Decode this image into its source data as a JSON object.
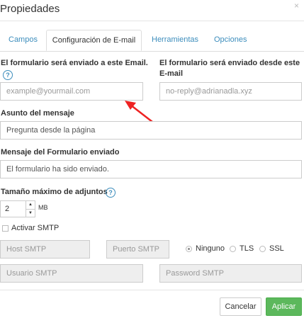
{
  "dialog": {
    "title": "Propiedades",
    "close": "×"
  },
  "tabs": [
    {
      "label": "Campos",
      "active": false
    },
    {
      "label": "Configuración de E-mail",
      "active": true
    },
    {
      "label": "Herramientas",
      "active": false
    },
    {
      "label": "Opciones",
      "active": false
    }
  ],
  "form": {
    "to_email": {
      "label": "El formulario será enviado a este Email.",
      "help": "?",
      "placeholder": "example@yourmail.com"
    },
    "from_email": {
      "label_line1": "El formulario será enviado desde este",
      "label_line2": "E-mail",
      "placeholder": "no-reply@adrianadla.xyz"
    },
    "subject": {
      "label": "Asunto del mensaje",
      "value": "Pregunta desde la página"
    },
    "sent_message": {
      "label": "Mensaje del Formulario enviado",
      "value": "El formulario ha sido enviado."
    },
    "max_attachment": {
      "label": "Tamaño máximo de adjuntos",
      "help": "?",
      "value": "2",
      "unit": "MB"
    },
    "smtp": {
      "activate_label": "Activar SMTP",
      "activated": false,
      "host_placeholder": "Host SMTP",
      "port_placeholder": "Puerto SMTP",
      "security_options": [
        "Ninguno",
        "TLS",
        "SSL"
      ],
      "security_selected": "Ninguno",
      "user_placeholder": "Usuario SMTP",
      "password_placeholder": "Password SMTP"
    }
  },
  "footer": {
    "cancel_label": "Cancelar",
    "apply_label": "Aplicar"
  }
}
